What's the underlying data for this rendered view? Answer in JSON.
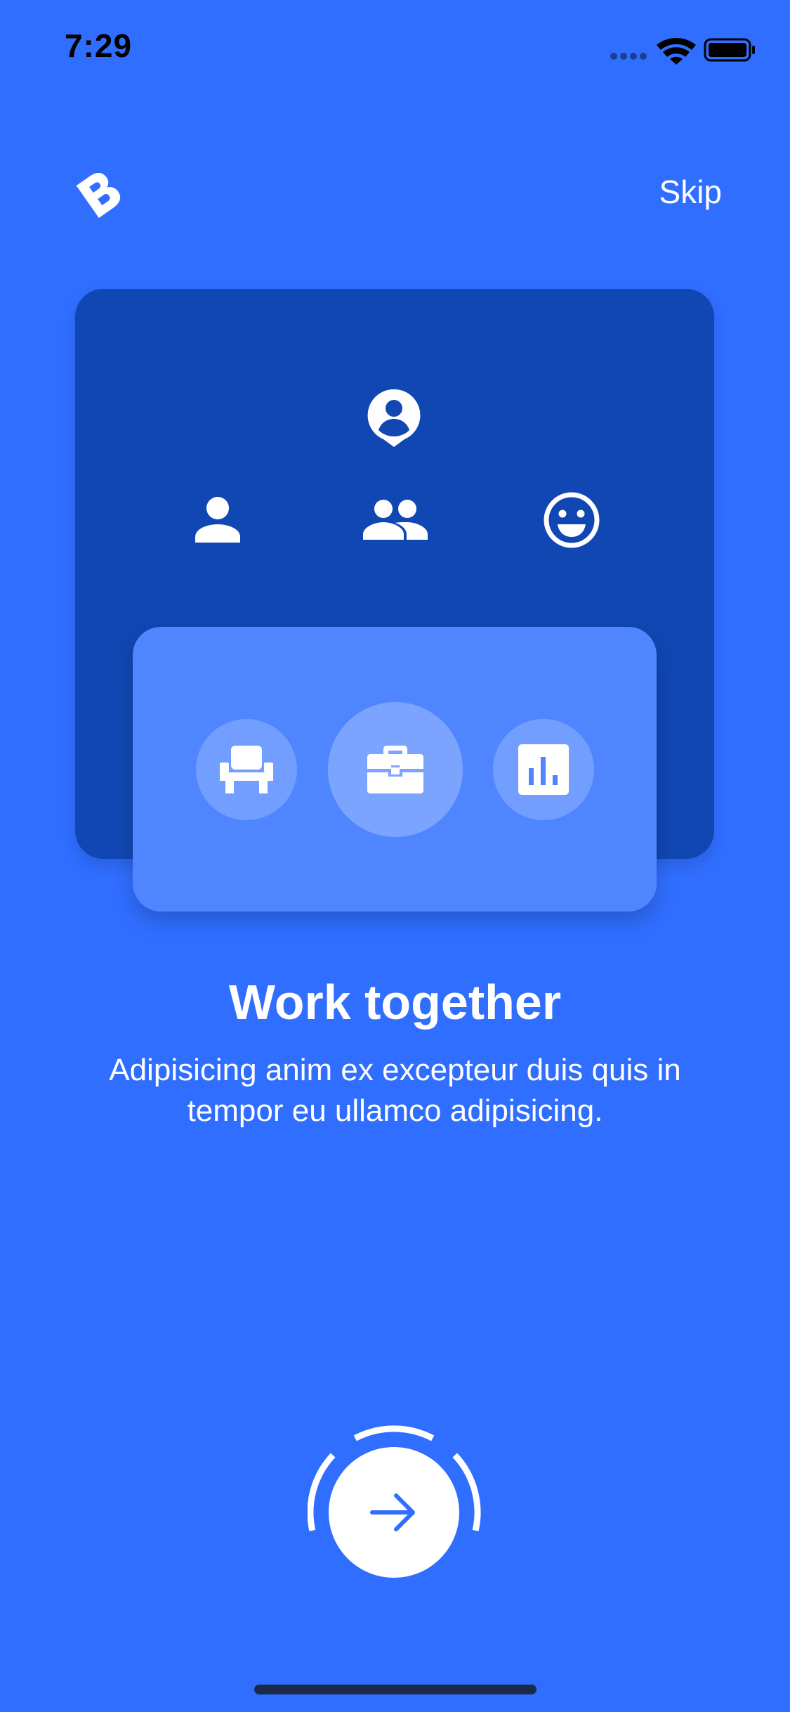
{
  "status_bar": {
    "time": "7:29"
  },
  "header": {
    "logo_icon": "b-logo-icon",
    "skip_label": "Skip"
  },
  "illustration": {
    "top_icons": [
      "account-pin-icon",
      "person-icon",
      "people-icon",
      "smiley-icon"
    ],
    "bottom_icons": [
      "seat-icon",
      "briefcase-icon",
      "bar-chart-icon"
    ]
  },
  "onboarding": {
    "title": "Work together",
    "subtitle": "Adipisicing anim ex excepteur duis quis in tempor eu ullamco adipisicing."
  },
  "next_button": {
    "icon": "arrow-right-icon",
    "progress_fraction": 0.33
  },
  "colors": {
    "background": "#306EFF",
    "back_card": "#1147B3",
    "front_card": "#4F86FF",
    "text": "#FFFFFF"
  }
}
